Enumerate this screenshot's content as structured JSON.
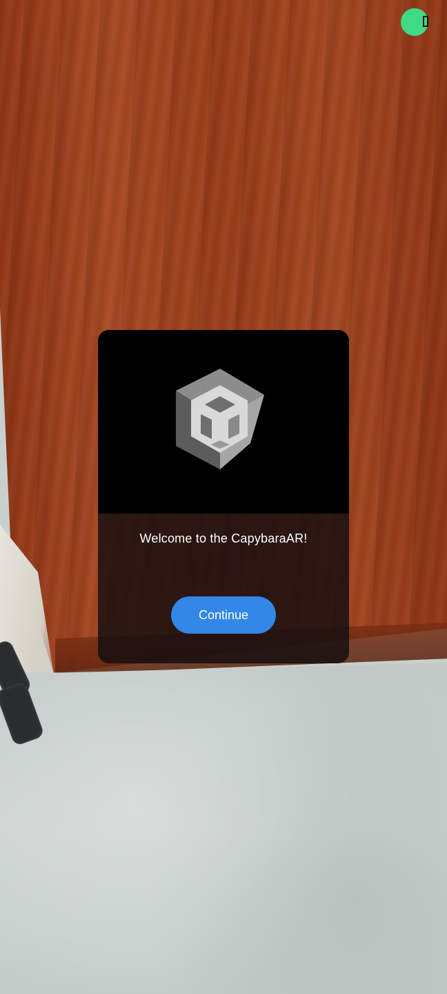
{
  "dialog": {
    "logo_icon": "unity-cube-logo",
    "welcome_text": "Welcome to the CapybaraAR!",
    "continue_label": "Continue"
  },
  "status": {
    "indicator_color": "#3ddb86",
    "icon": "recording-indicator-icon"
  },
  "colors": {
    "button": "#3287e7",
    "dialog_header": "#000000"
  }
}
